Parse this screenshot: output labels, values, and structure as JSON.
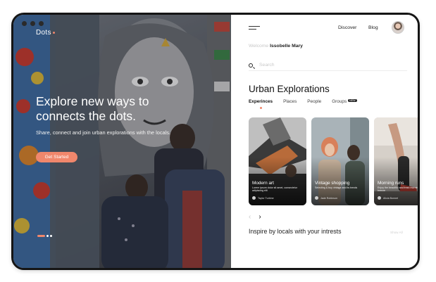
{
  "hero": {
    "brand": "Dots",
    "headline": "Explore new ways to connects the dots.",
    "subtext": "Share, connect and join urban explorations with the locals.",
    "cta_label": "Get Started"
  },
  "header": {
    "nav": [
      "Discover",
      "Blog"
    ]
  },
  "welcome": {
    "prefix": "Welcome",
    "name": "Issobelle Mary"
  },
  "search": {
    "placeholder": "Search"
  },
  "section": {
    "title": "Urban Explorations",
    "tabs": [
      {
        "label": "Experinces",
        "active": true
      },
      {
        "label": "Places",
        "active": false
      },
      {
        "label": "People",
        "active": false
      },
      {
        "label": "Groups",
        "active": false,
        "badge": "NEW"
      }
    ]
  },
  "cards": [
    {
      "title": "Modern art",
      "desc": "Lorem ipsum dolor sit amet, consectetur adipiscing elit",
      "author": "Taylor Turbine"
    },
    {
      "title": "Vintage shopping",
      "desc": "Selecting & buy vintage and its trends",
      "author": "Jade Robinson"
    },
    {
      "title": "Morning runs",
      "desc": "Enjoy the beautiful and fresh morning breeze",
      "author": "Alicia Bonnet"
    }
  ],
  "carousel": {
    "prev": "‹",
    "next": "›"
  },
  "inspire": {
    "title": "Inspire by locals with your intrests",
    "show_all": "Show All"
  },
  "colors": {
    "accent": "#f0876c",
    "dark": "#151515"
  }
}
